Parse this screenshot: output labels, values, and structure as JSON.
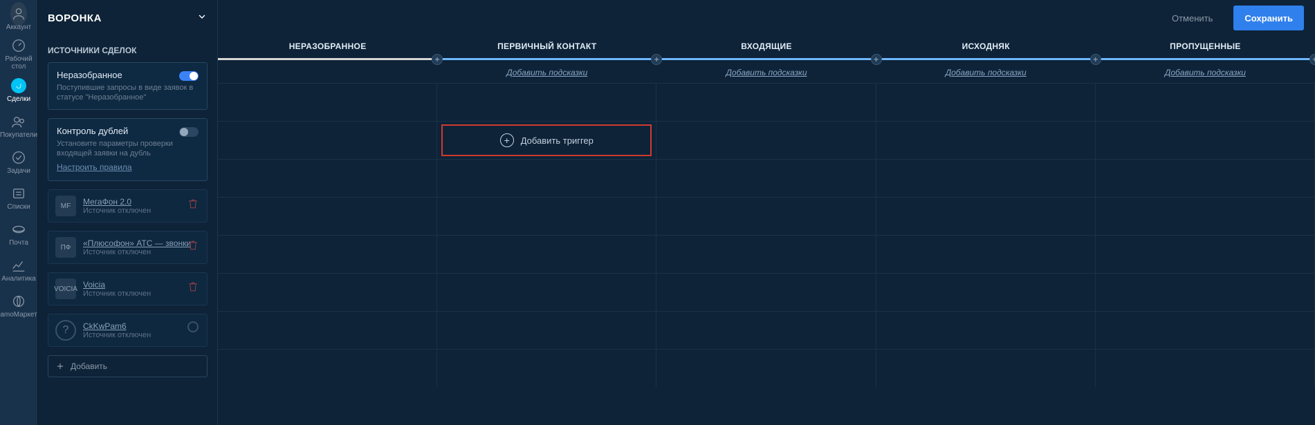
{
  "nav": {
    "items": [
      {
        "label": "Аккаунт",
        "name": "nav-account"
      },
      {
        "label": "Рабочий\nстол",
        "name": "nav-dashboard"
      },
      {
        "label": "Сделки",
        "name": "nav-deals",
        "active": true
      },
      {
        "label": "Покупатели",
        "name": "nav-buyers"
      },
      {
        "label": "Задачи",
        "name": "nav-tasks"
      },
      {
        "label": "Списки",
        "name": "nav-lists"
      },
      {
        "label": "Почта",
        "name": "nav-mail"
      },
      {
        "label": "Аналитика",
        "name": "nav-analytics"
      },
      {
        "label": "amoМаркет",
        "name": "nav-market"
      }
    ]
  },
  "panel": {
    "title": "ВОРОНКА",
    "section_title": "ИСТОЧНИКИ СДЕЛОК",
    "unsorted": {
      "title": "Неразобранное",
      "desc": "Поступившие запросы в виде заявок в статусе \"Неразобранное\"",
      "toggle_on": true
    },
    "dupes": {
      "title": "Контроль дублей",
      "desc": "Установите параметры проверки входящей заявки на дубль",
      "link": "Настроить правила",
      "toggle_on": false
    },
    "sources": [
      {
        "name": "МегаФон 2.0",
        "status": "Источник отключен",
        "has_delete": true,
        "badge": "MF",
        "radio": false
      },
      {
        "name": "«Плюсофон» АТС — звонки",
        "status": "Источник отключен",
        "has_delete": true,
        "badge": "ПФ",
        "radio": false
      },
      {
        "name": "Voicia",
        "status": "Источник отключен",
        "has_delete": true,
        "badge": "VOICIA",
        "radio": false
      },
      {
        "name": "CkKwPam6",
        "status": "Источник отключен",
        "has_delete": false,
        "badge": "?",
        "radio": true
      }
    ],
    "add_label": "Добавить"
  },
  "topbar": {
    "cancel": "Отменить",
    "save": "Сохранить"
  },
  "pipeline": {
    "stages": [
      {
        "label": "НЕРАЗОБРАННОЕ",
        "hint": ""
      },
      {
        "label": "ПЕРВИЧНЫЙ КОНТАКТ",
        "hint": "Добавить подсказки"
      },
      {
        "label": "ВХОДЯЩИЕ",
        "hint": "Добавить подсказки"
      },
      {
        "label": "ИСХОДНЯК",
        "hint": "Добавить подсказки"
      },
      {
        "label": "ПРОПУЩЕННЫЕ",
        "hint": "Добавить подсказки"
      }
    ],
    "add_trigger_label": "Добавить триггер",
    "grid_rows": 8
  }
}
